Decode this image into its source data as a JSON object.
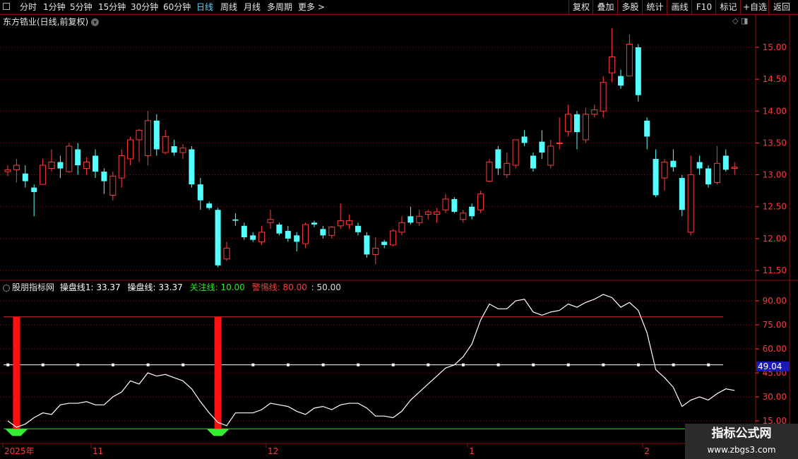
{
  "toolbar": {
    "square_icon": "square-icon",
    "periods": [
      "分时",
      "1分钟",
      "5分钟",
      "15分钟",
      "30分钟",
      "60分钟",
      "日线",
      "周线",
      "月线",
      "多周期",
      "更多 >"
    ],
    "active_period": "日线",
    "right_buttons": [
      "复权",
      "叠加",
      "多股",
      "统计",
      "画线",
      "F10",
      "标记",
      "+自选",
      "返回"
    ]
  },
  "stock": {
    "title": "东方锆业(日线,前复权)",
    "title_icon": "▾",
    "corner_icons": "◇ ◨"
  },
  "price_axis": [
    {
      "label": "15.00",
      "value": 15.0
    },
    {
      "label": "14.50",
      "value": 14.5
    },
    {
      "label": "14.00",
      "value": 14.0
    },
    {
      "label": "13.50",
      "value": 13.5
    },
    {
      "label": "13.00",
      "value": 13.0
    },
    {
      "label": "12.50",
      "value": 12.5
    },
    {
      "label": "12.00",
      "value": 12.0
    },
    {
      "label": "11.50",
      "value": 11.5
    }
  ],
  "candles": [
    [
      13.05,
      13.08,
      13.15,
      12.98
    ],
    [
      13.08,
      13.15,
      13.25,
      12.88
    ],
    [
      13.02,
      12.9,
      13.15,
      12.8
    ],
    [
      12.8,
      12.73,
      12.85,
      12.35
    ],
    [
      12.85,
      13.15,
      13.25,
      12.85
    ],
    [
      13.1,
      13.2,
      13.4,
      13.05
    ],
    [
      13.2,
      13.1,
      13.3,
      12.95
    ],
    [
      13.05,
      13.45,
      13.5,
      13.03
    ],
    [
      13.4,
      13.15,
      13.5,
      13.0
    ],
    [
      13.1,
      13.2,
      13.28,
      13.0
    ],
    [
      13.3,
      13.05,
      13.4,
      12.95
    ],
    [
      13.05,
      12.9,
      13.1,
      12.7
    ],
    [
      12.68,
      12.98,
      13.05,
      12.6
    ],
    [
      12.95,
      13.3,
      13.4,
      12.8
    ],
    [
      13.25,
      13.55,
      13.6,
      13.15
    ],
    [
      13.55,
      13.7,
      13.72,
      13.2
    ],
    [
      13.3,
      13.85,
      14.0,
      13.15
    ],
    [
      13.85,
      13.4,
      13.95,
      13.3
    ],
    [
      13.35,
      13.6,
      13.7,
      13.32
    ],
    [
      13.45,
      13.35,
      13.55,
      13.3
    ],
    [
      13.35,
      13.42,
      13.48,
      13.25
    ],
    [
      13.4,
      12.85,
      13.45,
      12.8
    ],
    [
      12.85,
      12.6,
      12.95,
      12.45
    ],
    [
      12.55,
      12.48,
      12.58,
      12.45
    ],
    [
      12.45,
      11.58,
      12.48,
      11.55
    ],
    [
      11.68,
      11.85,
      11.95,
      11.65
    ],
    [
      12.3,
      12.28,
      12.4,
      12.2
    ],
    [
      12.2,
      12.02,
      12.25,
      11.98
    ],
    [
      12.05,
      11.98,
      12.1,
      11.95
    ],
    [
      11.95,
      12.1,
      12.2,
      11.9
    ],
    [
      12.25,
      12.3,
      12.45,
      12.15
    ],
    [
      12.22,
      12.08,
      12.25,
      12.05
    ],
    [
      12.12,
      12.0,
      12.2,
      11.95
    ],
    [
      12.05,
      11.95,
      12.1,
      11.8
    ],
    [
      11.92,
      12.22,
      12.25,
      11.85
    ],
    [
      12.25,
      12.22,
      12.28,
      12.18
    ],
    [
      12.15,
      12.05,
      12.2,
      12.0
    ],
    [
      12.05,
      12.18,
      12.2,
      12.0
    ],
    [
      12.2,
      12.28,
      12.55,
      12.15
    ],
    [
      12.22,
      12.28,
      12.38,
      12.15
    ],
    [
      12.2,
      12.1,
      12.25,
      12.05
    ],
    [
      12.05,
      11.75,
      12.1,
      11.7
    ],
    [
      11.75,
      11.85,
      12.02,
      11.6
    ],
    [
      11.95,
      11.9,
      11.98,
      11.85
    ],
    [
      11.9,
      12.12,
      12.15,
      11.88
    ],
    [
      12.1,
      12.25,
      12.35,
      12.05
    ],
    [
      12.35,
      12.25,
      12.5,
      12.22
    ],
    [
      12.25,
      12.35,
      12.45,
      12.2
    ],
    [
      12.38,
      12.42,
      12.45,
      12.3
    ],
    [
      12.38,
      12.42,
      12.48,
      12.25
    ],
    [
      12.45,
      12.62,
      12.7,
      12.4
    ],
    [
      12.62,
      12.42,
      12.65,
      12.4
    ],
    [
      12.3,
      12.4,
      12.45,
      12.25
    ],
    [
      12.5,
      12.35,
      12.55,
      12.3
    ],
    [
      12.45,
      12.7,
      12.75,
      12.4
    ],
    [
      12.9,
      13.2,
      13.25,
      12.88
    ],
    [
      13.4,
      13.1,
      13.45,
      13.0
    ],
    [
      13.0,
      13.18,
      13.35,
      12.95
    ],
    [
      13.15,
      13.55,
      13.55,
      13.1
    ],
    [
      13.6,
      13.5,
      13.7,
      13.45
    ],
    [
      13.3,
      13.1,
      13.35,
      13.05
    ],
    [
      13.52,
      13.35,
      13.7,
      13.25
    ],
    [
      13.15,
      13.45,
      13.55,
      13.1
    ],
    [
      13.5,
      13.5,
      13.9,
      13.4
    ],
    [
      13.68,
      13.95,
      14.1,
      13.6
    ],
    [
      13.95,
      13.67,
      14.0,
      13.4
    ],
    [
      13.55,
      13.95,
      14.05,
      13.5
    ],
    [
      13.95,
      14.02,
      14.1,
      13.9
    ],
    [
      14.0,
      14.45,
      14.55,
      13.9
    ],
    [
      14.6,
      14.85,
      15.3,
      14.45
    ],
    [
      14.55,
      14.4,
      14.65,
      14.35
    ],
    [
      14.55,
      15.05,
      15.2,
      14.55
    ],
    [
      15.0,
      14.25,
      15.05,
      14.15
    ],
    [
      13.85,
      13.6,
      13.9,
      13.4
    ],
    [
      13.25,
      12.68,
      13.4,
      12.65
    ],
    [
      12.95,
      13.2,
      13.25,
      12.75
    ],
    [
      13.22,
      13.12,
      13.4,
      13.05
    ],
    [
      12.95,
      12.45,
      13.0,
      12.35
    ],
    [
      12.1,
      13.0,
      13.3,
      12.05
    ],
    [
      13.2,
      13.1,
      13.3,
      13.0
    ],
    [
      13.1,
      12.85,
      13.15,
      12.8
    ],
    [
      12.88,
      13.18,
      13.45,
      12.85
    ],
    [
      13.3,
      13.08,
      13.4,
      13.05
    ],
    [
      13.1,
      13.12,
      13.2,
      13.0
    ]
  ],
  "indicator": {
    "name": "股朋指标网",
    "line1_label": "操盘线1: 33.37",
    "line2_label": "操盘线: 33.37",
    "focus_label": "关注线: 10.00",
    "alert_label": "警惕线: 80.00",
    "mid_label": ": 50.00",
    "axis": [
      {
        "label": "90.00",
        "value": 90
      },
      {
        "label": "75.00",
        "value": 75
      },
      {
        "label": "60.00",
        "value": 60
      },
      {
        "label": "45.00",
        "value": 45
      },
      {
        "label": "30.00",
        "value": 30
      },
      {
        "label": "15.00",
        "value": 15
      }
    ],
    "current_value": "49.04",
    "levels": {
      "alert": 80,
      "mid": 50,
      "focus": 10
    },
    "line": [
      15,
      11,
      13,
      17,
      20,
      19,
      25,
      26,
      26,
      27,
      25,
      25,
      30,
      33,
      40,
      38,
      45,
      43,
      44,
      42,
      40,
      35,
      27,
      20,
      14,
      12,
      20,
      20,
      20,
      22,
      26,
      25,
      24,
      21,
      19,
      23,
      24,
      22,
      25,
      26,
      26,
      23,
      18,
      18,
      17,
      21,
      28,
      33,
      38,
      43,
      48,
      50,
      55,
      63,
      78,
      88,
      85,
      85,
      90,
      91,
      83,
      81,
      83,
      84,
      88,
      86,
      89,
      91,
      94,
      92,
      86,
      89,
      84,
      70,
      47,
      42,
      36,
      24,
      28,
      30,
      28,
      32,
      35,
      34
    ],
    "red_bars_at": [
      1,
      24
    ],
    "dot_positions": [
      0.5,
      4.5,
      8.5,
      12.5,
      16.5,
      20.5,
      24.5,
      28.5,
      32.5,
      36.5,
      40.5,
      44.5,
      48.5,
      52.5,
      56.5,
      60.5,
      64.5,
      68.5,
      72.5,
      76.5,
      80.5
    ]
  },
  "x_axis": [
    {
      "label": "2025年",
      "index": 0
    },
    {
      "label": "11",
      "index": 10
    },
    {
      "label": "12",
      "index": 30
    },
    {
      "label": "1",
      "index": 53
    },
    {
      "label": "2",
      "index": 73
    }
  ],
  "watermark": {
    "line1": "指标公式网",
    "line2": "www.zbgs3.com"
  },
  "colors": {
    "up": "#ff3b3b",
    "down": "#54ffff",
    "alert": "#cc2222",
    "focus": "#00dd00",
    "mid": "#ffffff",
    "line": "#ffffff",
    "bar": "#ff1010",
    "fill": "#33ee33"
  }
}
